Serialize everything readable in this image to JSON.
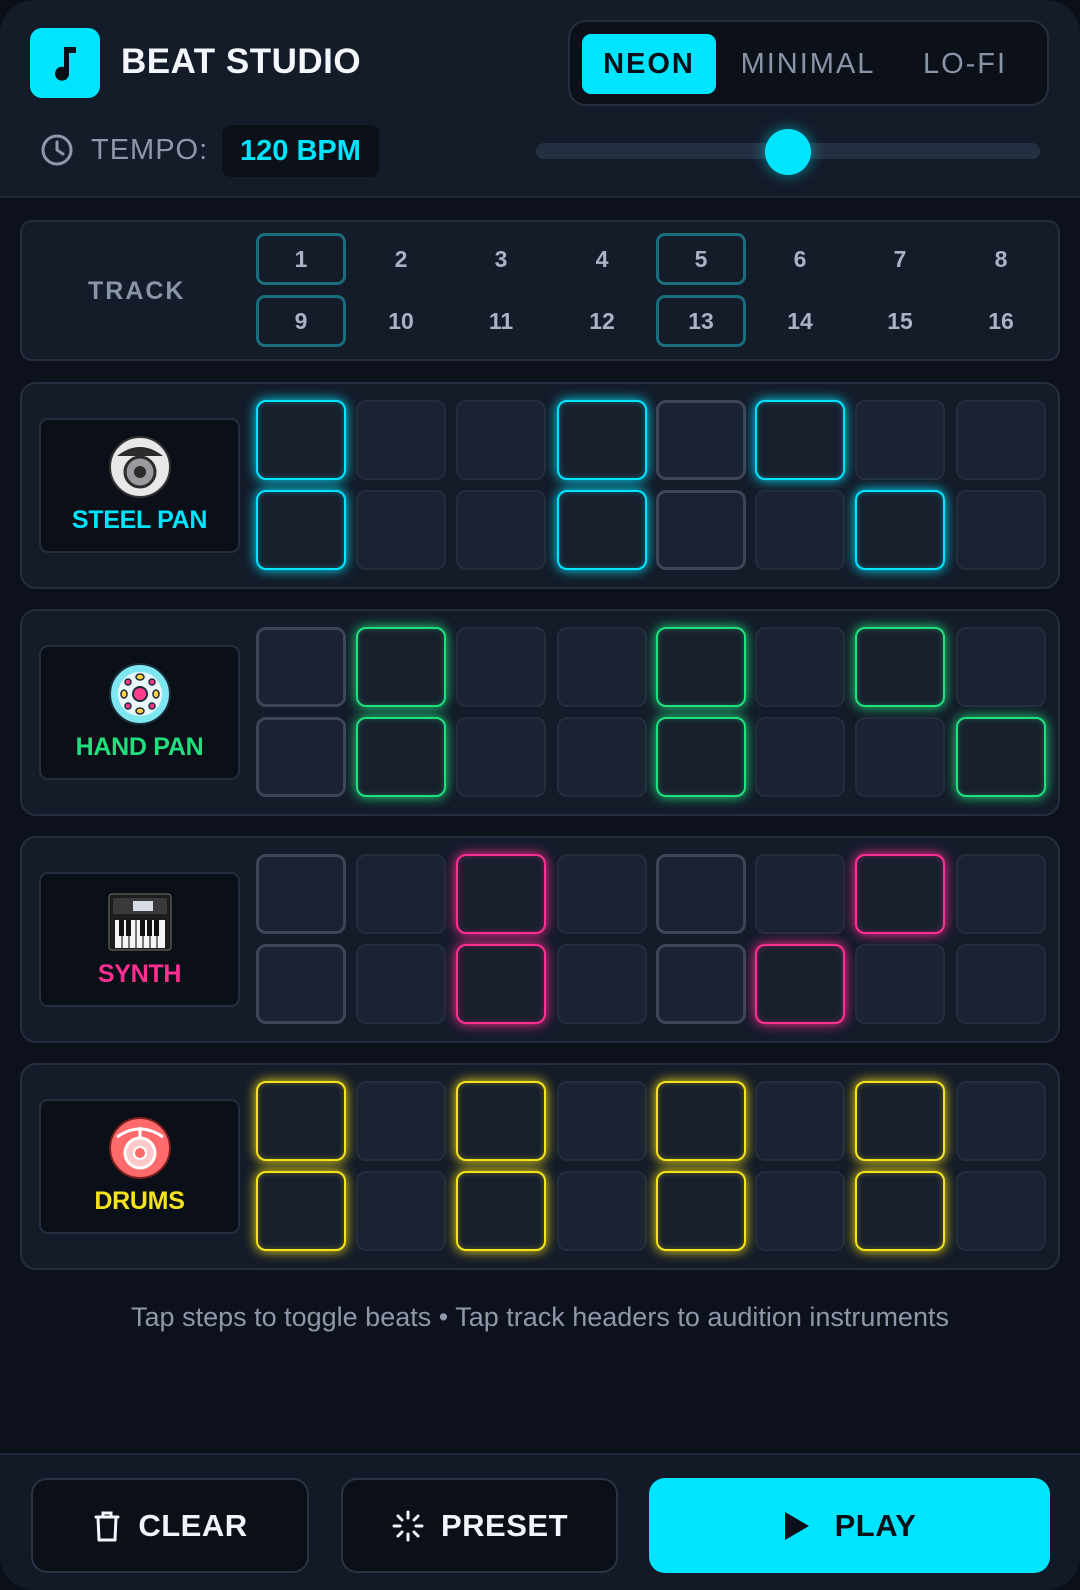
{
  "app": {
    "title": "BEAT STUDIO",
    "logo_icon": "music-note-icon"
  },
  "themes": [
    {
      "label": "NEON",
      "active": true
    },
    {
      "label": "MINIMAL",
      "active": false
    },
    {
      "label": "LO-FI",
      "active": false
    }
  ],
  "tempo": {
    "label": "TEMPO:",
    "value_text": "120 BPM",
    "bpm": 120,
    "slider_fraction": 0.5
  },
  "steps": {
    "track_label": "TRACK",
    "numbers": [
      "1",
      "2",
      "3",
      "4",
      "5",
      "6",
      "7",
      "8",
      "9",
      "10",
      "11",
      "12",
      "13",
      "14",
      "15",
      "16"
    ],
    "marked": [
      1,
      5,
      9,
      13
    ]
  },
  "tracks": [
    {
      "name": "STEEL PAN",
      "icon": "steel-pan-icon",
      "color": "#00e5ff",
      "active_steps": [
        1,
        4,
        6,
        9,
        12,
        15
      ]
    },
    {
      "name": "HAND PAN",
      "icon": "hand-pan-icon",
      "color": "#1fe07d",
      "active_steps": [
        2,
        5,
        7,
        10,
        13,
        16
      ]
    },
    {
      "name": "SYNTH",
      "icon": "synth-keyboard-icon",
      "color": "#ff2e92",
      "active_steps": [
        3,
        7,
        11,
        14
      ]
    },
    {
      "name": "DRUMS",
      "icon": "drum-icon",
      "color": "#f4e21a",
      "active_steps": [
        1,
        3,
        5,
        7,
        9,
        11,
        13,
        15
      ]
    }
  ],
  "hint": "Tap steps to toggle beats • Tap track headers to audition instruments",
  "buttons": {
    "clear": {
      "label": "CLEAR",
      "icon": "trash-icon"
    },
    "preset": {
      "label": "PRESET",
      "icon": "sparkle-loader-icon"
    },
    "play": {
      "label": "PLAY",
      "icon": "play-icon"
    }
  },
  "colors": {
    "accent": "#00e5ff",
    "background": "#0c111b",
    "panel": "#141b29"
  }
}
